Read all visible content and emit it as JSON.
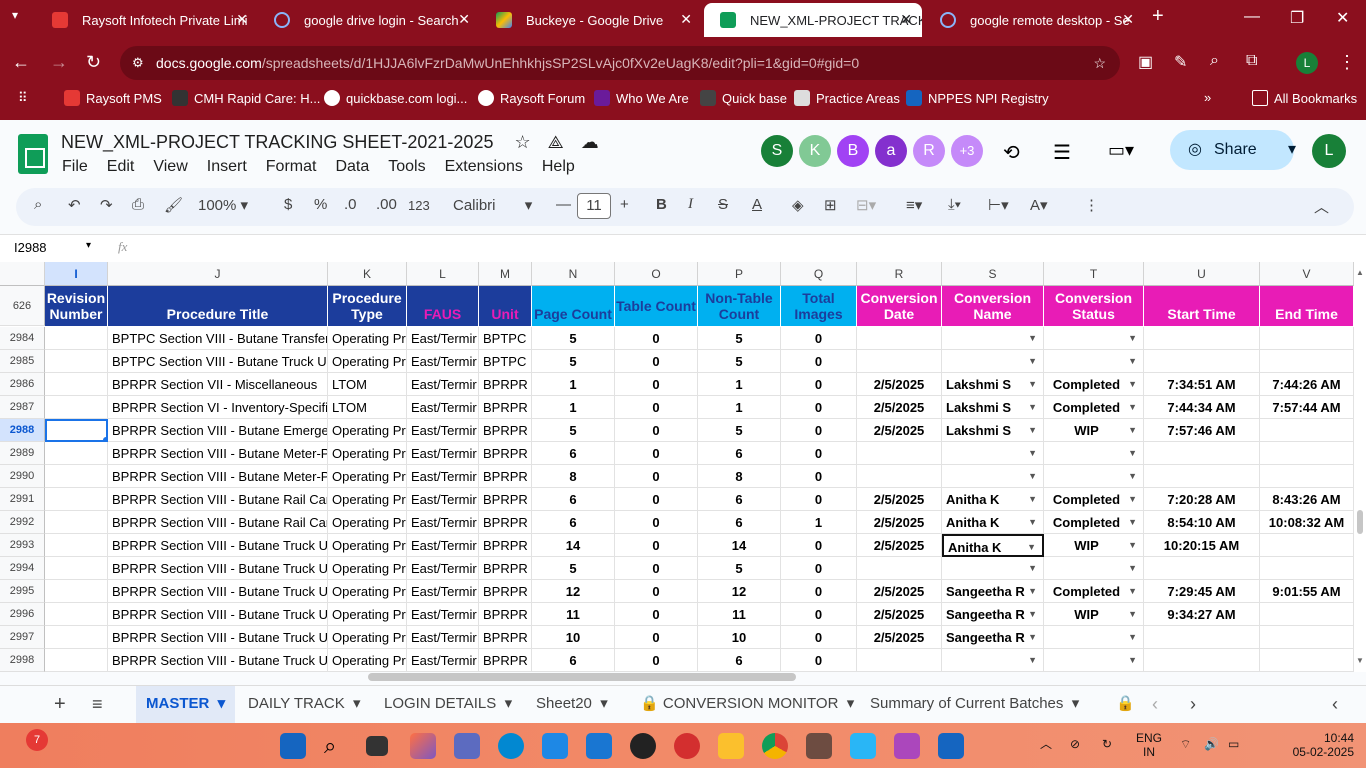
{
  "browser": {
    "tabs": [
      {
        "title": "Raysoft Infotech Private Limi",
        "favcolor": "#e53935"
      },
      {
        "title": "google drive login - Search",
        "favcolor": "#8ab4f8"
      },
      {
        "title": "Buckeye - Google Drive",
        "favcolor": "#fbbc04"
      },
      {
        "title": "NEW_XML-PROJECT TRACKI",
        "favcolor": "#0f9d58"
      },
      {
        "title": "google remote desktop - Se",
        "favcolor": "#8ab4f8"
      }
    ],
    "url_host": "docs.google.com",
    "url_path": "/spreadsheets/d/1HJJA6lvFzrDaMwUnEhhkhjsSP2SLvAjc0fXv2eUagK8/edit?pli=1&gid=0#gid=0",
    "bookmarks": [
      "Raysoft PMS",
      "CMH Rapid Care: H...",
      "quickbase.com logi...",
      "Raysoft Forum",
      "Who We Are",
      "Quick base",
      "Practice Areas",
      "NPPES NPI Registry",
      "All Bookmarks"
    ],
    "profile_initial": "L"
  },
  "sheet": {
    "title": "NEW_XML-PROJECT TRACKING SHEET-2021-2025",
    "menus": [
      "File",
      "Edit",
      "View",
      "Insert",
      "Format",
      "Data",
      "Tools",
      "Extensions",
      "Help"
    ],
    "collaborators": [
      {
        "initial": "S",
        "color": "#188038"
      },
      {
        "initial": "K",
        "color": "#81c995"
      },
      {
        "initial": "B",
        "color": "#a142f4"
      },
      {
        "initial": "a",
        "color": "#8430ce"
      },
      {
        "initial": "R",
        "color": "#c58af9"
      },
      {
        "initial": "+3",
        "color": "#c58af9"
      }
    ],
    "share_label": "Share",
    "user_initial": "L",
    "toolbar": {
      "zoom": "100%",
      "currency": "$",
      "percent": "%",
      "dec_dec": ".0",
      "dec_inc": ".00",
      "number_fmt": "123",
      "font": "Calibri",
      "font_size": "11",
      "bold": "B",
      "italic": "I"
    },
    "name_box": "I2988",
    "fx": "fx",
    "col_letters": [
      "I",
      "J",
      "K",
      "L",
      "M",
      "N",
      "O",
      "P",
      "Q",
      "R",
      "S",
      "T",
      "U",
      "V"
    ],
    "header_row_num": "626",
    "headers": [
      "Revision Number",
      "Procedure Title",
      "Procedure Type",
      "FAUS",
      "Unit",
      "Page Count",
      "Table Count",
      "Non-Table Count",
      "Total Images",
      "Conversion Date",
      "Conversion Name",
      "Conversion Status",
      "Start Time",
      "End Time"
    ],
    "rows": [
      {
        "num": "2984",
        "cells": [
          "",
          "BPTPC Section VIII - Butane Transfer",
          "Operating Pr",
          "East/Termir",
          "BPTPC",
          "5",
          "0",
          "5",
          "0",
          "",
          "",
          "",
          "",
          ""
        ]
      },
      {
        "num": "2985",
        "cells": [
          "",
          "BPTPC Section VIII - Butane Truck Ur",
          "Operating Pr",
          "East/Termir",
          "BPTPC",
          "5",
          "0",
          "5",
          "0",
          "",
          "",
          "",
          "",
          ""
        ]
      },
      {
        "num": "2986",
        "cells": [
          "",
          "BPRPR Section VII - Miscellaneous",
          "LTOM",
          "East/Termir",
          "BPRPR",
          "1",
          "0",
          "1",
          "0",
          "2/5/2025",
          "Lakshmi S",
          "Completed",
          "7:34:51 AM",
          "7:44:26 AM"
        ]
      },
      {
        "num": "2987",
        "cells": [
          "",
          "BPRPR Section VI - Inventory-Specifi",
          "LTOM",
          "East/Termir",
          "BPRPR",
          "1",
          "0",
          "1",
          "0",
          "2/5/2025",
          "Lakshmi S",
          "Completed",
          "7:44:34 AM",
          "7:57:44 AM"
        ]
      },
      {
        "num": "2988",
        "cells": [
          "",
          "BPRPR Section VIII - Butane Emerger",
          "Operating Pr",
          "East/Termir",
          "BPRPR",
          "5",
          "0",
          "5",
          "0",
          "2/5/2025",
          "Lakshmi S",
          "WIP",
          "7:57:46 AM",
          ""
        ]
      },
      {
        "num": "2989",
        "cells": [
          "",
          "BPRPR Section VIII - Butane Meter-P",
          "Operating Pr",
          "East/Termir",
          "BPRPR",
          "6",
          "0",
          "6",
          "0",
          "",
          "",
          "",
          "",
          ""
        ]
      },
      {
        "num": "2990",
        "cells": [
          "",
          "BPRPR Section VIII - Butane Meter-P",
          "Operating Pr",
          "East/Termir",
          "BPRPR",
          "8",
          "0",
          "8",
          "0",
          "",
          "",
          "",
          "",
          ""
        ]
      },
      {
        "num": "2991",
        "cells": [
          "",
          "BPRPR Section VIII - Butane Rail Car",
          "Operating Pr",
          "East/Termir",
          "BPRPR",
          "6",
          "0",
          "6",
          "0",
          "2/5/2025",
          "Anitha K",
          "Completed",
          "7:20:28 AM",
          "8:43:26 AM"
        ]
      },
      {
        "num": "2992",
        "cells": [
          "",
          "BPRPR Section VIII - Butane Rail Car",
          "Operating Pr",
          "East/Termir",
          "BPRPR",
          "6",
          "0",
          "6",
          "1",
          "2/5/2025",
          "Anitha K",
          "Completed",
          "8:54:10 AM",
          "10:08:32 AM"
        ]
      },
      {
        "num": "2993",
        "cells": [
          "",
          "BPRPR Section VIII - Butane Truck Ur",
          "Operating Pr",
          "East/Termir",
          "BPRPR",
          "14",
          "0",
          "14",
          "0",
          "2/5/2025",
          "Anitha K",
          "WIP",
          "10:20:15 AM",
          ""
        ]
      },
      {
        "num": "2994",
        "cells": [
          "",
          "BPRPR Section VIII - Butane Truck Ur",
          "Operating Pr",
          "East/Termir",
          "BPRPR",
          "5",
          "0",
          "5",
          "0",
          "",
          "",
          "",
          "",
          ""
        ]
      },
      {
        "num": "2995",
        "cells": [
          "",
          "BPRPR Section VIII - Butane Truck Ur",
          "Operating Pr",
          "East/Termir",
          "BPRPR",
          "12",
          "0",
          "12",
          "0",
          "2/5/2025",
          "Sangeetha R",
          "Completed",
          "7:29:45 AM",
          "9:01:55 AM"
        ]
      },
      {
        "num": "2996",
        "cells": [
          "",
          "BPRPR Section VIII - Butane Truck Ur",
          "Operating Pr",
          "East/Termir",
          "BPRPR",
          "11",
          "0",
          "11",
          "0",
          "2/5/2025",
          "Sangeetha R",
          "WIP",
          "9:34:27 AM",
          ""
        ]
      },
      {
        "num": "2997",
        "cells": [
          "",
          "BPRPR Section VIII - Butane Truck Ur",
          "Operating Pr",
          "East/Termir",
          "BPRPR",
          "10",
          "0",
          "10",
          "0",
          "2/5/2025",
          "Sangeetha R",
          "",
          "",
          ""
        ]
      },
      {
        "num": "2998",
        "cells": [
          "",
          "BPRPR Section VIII - Butane Truck Ur",
          "Operating Pr",
          "East/Termir",
          "BPRPR",
          "6",
          "0",
          "6",
          "0",
          "",
          "",
          "",
          "",
          ""
        ]
      }
    ],
    "sheet_tabs": [
      "MASTER",
      "DAILY TRACK",
      "LOGIN DETAILS",
      "Sheet20",
      "CONVERSION MONITOR",
      "Summary of Current Batches"
    ],
    "colors": {
      "header_blue": "#1c3d9c",
      "header_teal": "#00b0f0",
      "header_magenta": "#e81cb6"
    }
  },
  "taskbar": {
    "notif_count": "7",
    "lang": "ENG",
    "region": "IN",
    "time": "10:44",
    "date": "05-02-2025"
  }
}
